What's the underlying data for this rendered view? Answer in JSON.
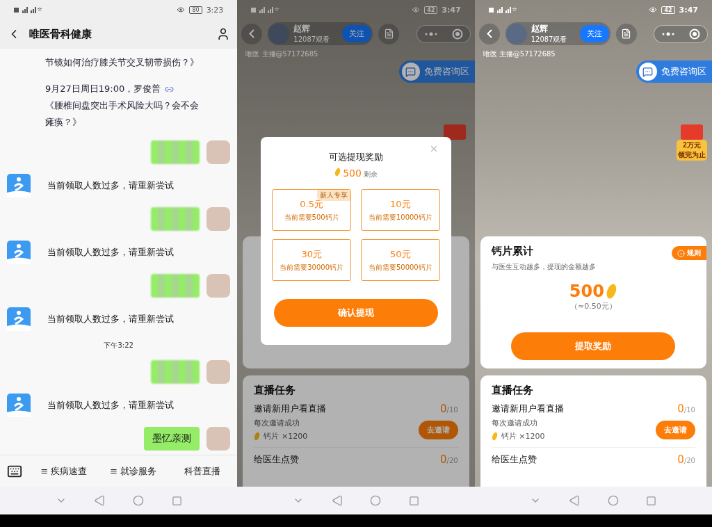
{
  "chat_screen": {
    "status": {
      "time": "3:23",
      "battery": "80"
    },
    "title": "唯医骨科健康",
    "messages": [
      {
        "kind": "notice",
        "text": "节镜如何治疗膝关节交叉韧带损伤？》"
      },
      {
        "kind": "notice",
        "text": "9月27日周日19:00，罗俊普",
        "link": true,
        "title": "《腰椎间盘突出手术风险大吗？会不会瘫痪？》"
      },
      {
        "kind": "user_hidden"
      },
      {
        "kind": "bot",
        "text": "当前领取人数过多，请重新尝试"
      },
      {
        "kind": "user_hidden"
      },
      {
        "kind": "bot",
        "text": "当前领取人数过多，请重新尝试"
      },
      {
        "kind": "user_hidden"
      },
      {
        "kind": "bot",
        "text": "当前领取人数过多，请重新尝试"
      },
      {
        "kind": "time",
        "text": "下午3:22"
      },
      {
        "kind": "user_hidden"
      },
      {
        "kind": "bot",
        "text": "当前领取人数过多，请重新尝试"
      },
      {
        "kind": "user",
        "text": "墨忆亲测"
      }
    ],
    "menu": [
      {
        "label": "≡ 疾病速查"
      },
      {
        "label": "≡ 就诊服务"
      },
      {
        "label": "科普直播"
      }
    ]
  },
  "live_screens": [
    {
      "status": {
        "time": "3:47",
        "battery": "42"
      },
      "host": {
        "name": "赵辉",
        "viewers": "12087观看",
        "follow": "关注"
      },
      "host_line": "唯医 主播@57172685",
      "consult": "免费咨询区",
      "tasks": {
        "title": "直播任务",
        "items": [
          {
            "title": "邀请新用户看直播",
            "done": "0",
            "total": "/10",
            "note": "每次邀请成功",
            "reward": "钙片 ×1200",
            "action": "去邀请"
          },
          {
            "title": "给医生点赞",
            "done": "0",
            "total": "/20"
          }
        ]
      },
      "dialog": {
        "title": "可选提现奖励",
        "balance": "500",
        "balance_note": "剩余",
        "options": [
          {
            "amount": "0.5元",
            "need": "当前需要500钙片",
            "badge": "新人专享"
          },
          {
            "amount": "10元",
            "need": "当前需要10000钙片"
          },
          {
            "amount": "30元",
            "need": "当前需要30000钙片"
          },
          {
            "amount": "50元",
            "need": "当前需要50000钙片"
          }
        ],
        "confirm": "确认提现"
      }
    },
    {
      "status": {
        "time": "3:47",
        "battery": "42"
      },
      "host": {
        "name": "赵辉",
        "viewers": "12087观看",
        "follow": "关注"
      },
      "host_line": "唯医 主播@57172685",
      "consult": "免费咨询区",
      "red_packet": [
        "2万元",
        "领完为止"
      ],
      "card": {
        "title": "钙片累计",
        "rules": "规则",
        "subtitle": "与医生互动越多，提现的金额越多",
        "amount": "500",
        "equivalent": "（≈0.50元）",
        "action": "提取奖励"
      },
      "tasks": {
        "title": "直播任务",
        "items": [
          {
            "title": "邀请新用户看直播",
            "done": "0",
            "total": "/10",
            "note": "每次邀请成功",
            "reward": "钙片 ×1200",
            "action": "去邀请"
          },
          {
            "title": "给医生点赞",
            "done": "0",
            "total": "/20"
          }
        ]
      }
    }
  ]
}
